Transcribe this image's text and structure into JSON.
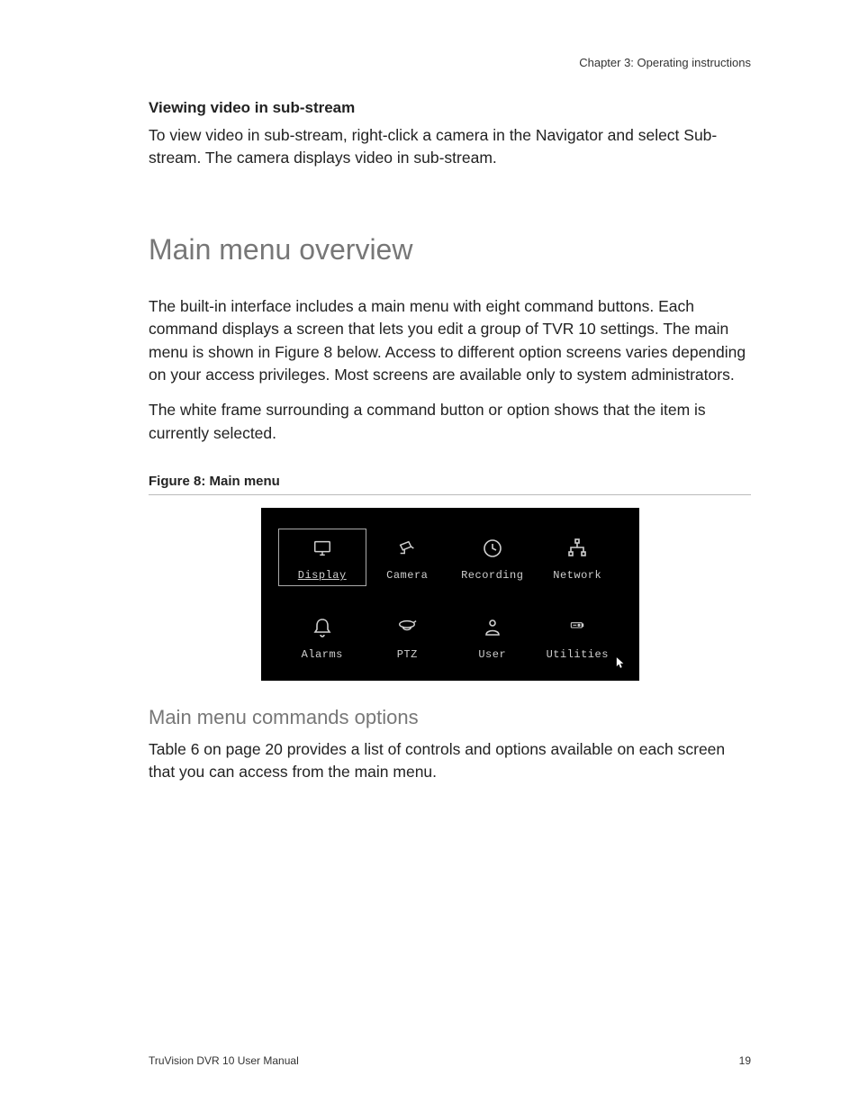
{
  "chapter": "Chapter 3: Operating instructions",
  "sub1_title": "Viewing video in sub-stream",
  "sub1_body": "To view video in sub-stream, right-click a camera in the Navigator and select Sub-stream. The camera displays video in sub-stream.",
  "h1": "Main menu overview",
  "p1": "The built-in interface includes a main menu with eight command buttons. Each command displays a screen that lets you edit a group of TVR 10 settings. The main menu is shown in Figure 8 below. Access to different option screens varies depending on your access privileges. Most screens are available only to system administrators.",
  "p2": "The white frame surrounding a command button or option shows that the item is currently selected.",
  "figcap": "Figure 8: Main menu",
  "menu": {
    "items": [
      {
        "label": "Display",
        "icon": "monitor",
        "selected": true
      },
      {
        "label": "Camera",
        "icon": "camera",
        "selected": false
      },
      {
        "label": "Recording",
        "icon": "clock",
        "selected": false
      },
      {
        "label": "Network",
        "icon": "network",
        "selected": false
      },
      {
        "label": "Alarms",
        "icon": "bell",
        "selected": false
      },
      {
        "label": "PTZ",
        "icon": "ptz",
        "selected": false
      },
      {
        "label": "User",
        "icon": "user",
        "selected": false
      },
      {
        "label": "Utilities",
        "icon": "battery",
        "selected": false
      }
    ]
  },
  "h2": "Main menu commands options",
  "p3": "Table 6 on page 20 provides a list of controls and options available on each screen that you can access from the main menu.",
  "footer_left": "TruVision DVR 10 User Manual",
  "footer_right": "19"
}
